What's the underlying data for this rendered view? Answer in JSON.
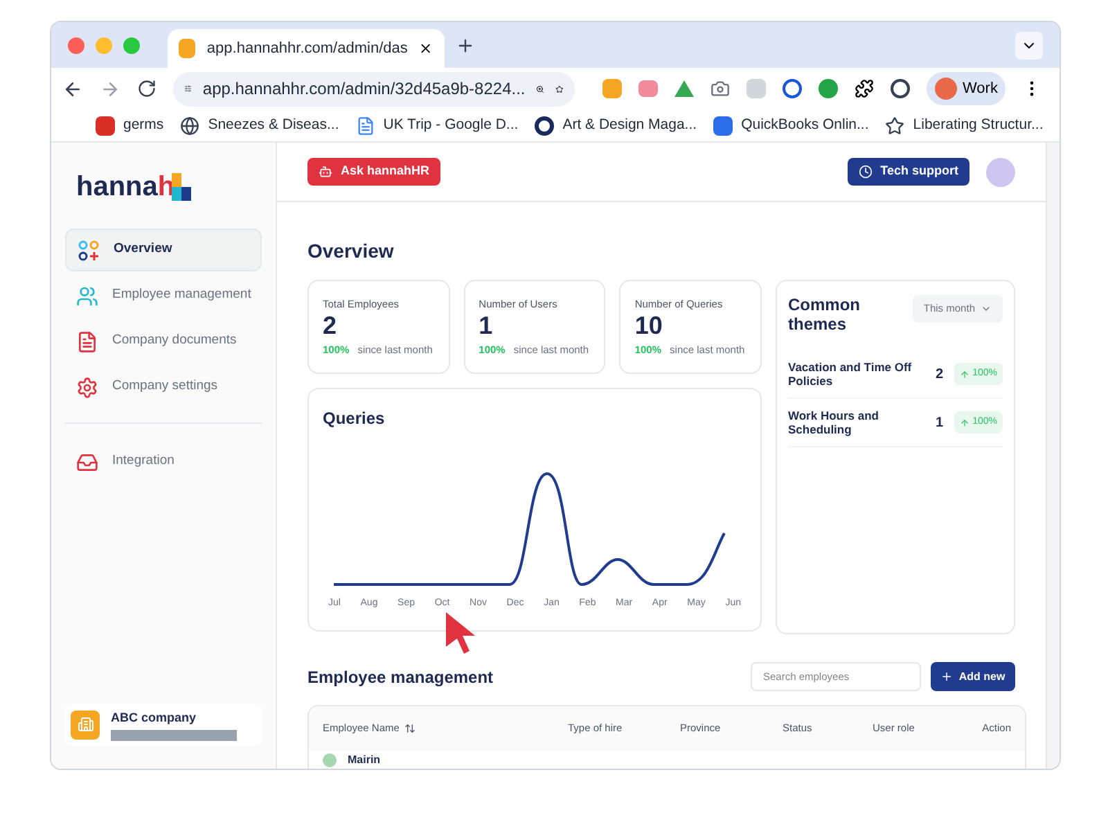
{
  "browser": {
    "tab_title": "app.hannahhr.com/admin/das",
    "url": "app.hannahhr.com/admin/32d45a9b-8224...",
    "profile": "Work",
    "bookmarks": [
      {
        "label": "germs",
        "kind": "pdf"
      },
      {
        "label": "Sneezes & Diseas...",
        "kind": "globe"
      },
      {
        "label": "UK Trip - Google D...",
        "kind": "doc"
      },
      {
        "label": "Art & Design Maga...",
        "kind": "ring"
      },
      {
        "label": "QuickBooks Onlin...",
        "kind": "app"
      },
      {
        "label": "Liberating Structur...",
        "kind": "star"
      }
    ]
  },
  "sidebar": {
    "logo": {
      "main": "hanna",
      "accent": "h"
    },
    "nav_groups": [
      [
        {
          "label": "Overview",
          "kind": "overview",
          "selected": true
        },
        {
          "label": "Employee management",
          "kind": "users",
          "selected": false
        },
        {
          "label": "Company documents",
          "kind": "document",
          "selected": false
        },
        {
          "label": "Company settings",
          "kind": "settings",
          "selected": false
        }
      ],
      [
        {
          "label": "Integration",
          "kind": "inbox",
          "selected": false
        }
      ]
    ],
    "company": {
      "name": "ABC company"
    }
  },
  "header": {
    "ask_button": "Ask hannahHR",
    "support_button": "Tech support"
  },
  "overview": {
    "title": "Overview",
    "stats": [
      {
        "label": "Total Employees",
        "value": "2",
        "change": "100%",
        "note": "since last month"
      },
      {
        "label": "Number of Users",
        "value": "1",
        "change": "100%",
        "note": "since last month"
      },
      {
        "label": "Number of Queries",
        "value": "10",
        "change": "100%",
        "note": "since last month"
      }
    ],
    "queries": {
      "title": "Queries",
      "x_labels": [
        "Jul",
        "Aug",
        "Sep",
        "Oct",
        "Nov",
        "Dec",
        "Jan",
        "Feb",
        "Mar",
        "Apr",
        "May",
        "Jun"
      ]
    },
    "themes": {
      "title": "Common themes",
      "filter": "This month",
      "items": [
        {
          "label": "Vacation and Time Off Policies",
          "count": "2",
          "change": "100%"
        },
        {
          "label": "Work Hours and Scheduling",
          "count": "1",
          "change": "100%"
        }
      ]
    }
  },
  "employees": {
    "title": "Employee management",
    "search_placeholder": "Search employees",
    "add_button": "Add new",
    "columns": [
      {
        "label": "Employee Name",
        "sortable": true
      },
      {
        "label": "Type of hire",
        "sortable": false
      },
      {
        "label": "Province",
        "sortable": false
      },
      {
        "label": "Status",
        "sortable": false
      },
      {
        "label": "User role",
        "sortable": false
      },
      {
        "label": "Action",
        "sortable": false
      }
    ],
    "rows": [
      {
        "name": "Mairin"
      }
    ]
  }
}
